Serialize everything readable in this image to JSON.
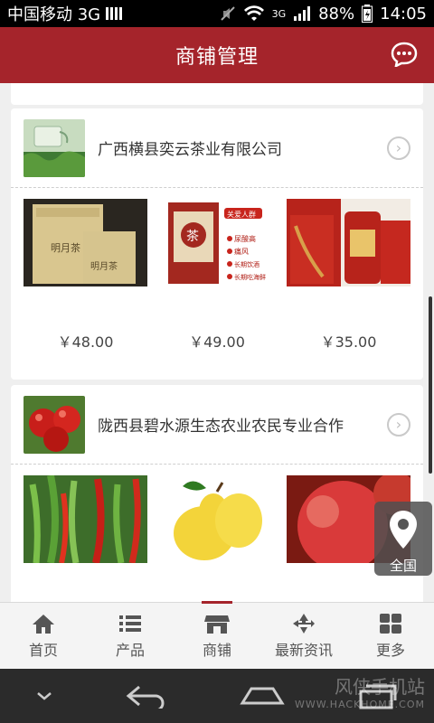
{
  "status": {
    "carrier": "中国移动 3G",
    "network": "3G",
    "battery": "88%",
    "time": "14:05"
  },
  "header": {
    "title": "商铺管理"
  },
  "shops": [
    {
      "name": "广西横县奕云茶业有限公司",
      "products": [
        {
          "price": "￥48.00"
        },
        {
          "price": "￥49.00"
        },
        {
          "price": "￥35.00"
        }
      ]
    },
    {
      "name": "陇西县碧水源生态农业农民专业合作"
    }
  ],
  "product_text": {
    "tea_box_badge": "关爱人群",
    "tea_box_items": [
      "尿酸高",
      "痛风",
      "长期饮酒",
      "长期吃海鲜"
    ]
  },
  "location_button": {
    "label": "全国"
  },
  "tabs": [
    {
      "label": "首页",
      "icon": "home-icon"
    },
    {
      "label": "产品",
      "icon": "list-icon"
    },
    {
      "label": "商铺",
      "icon": "store-icon",
      "active": true
    },
    {
      "label": "最新资讯",
      "icon": "news-icon"
    },
    {
      "label": "更多",
      "icon": "grid-icon"
    }
  ],
  "watermark": {
    "main": "风侠手机站",
    "sub": "WWW.HACKHOME.COM"
  },
  "colors": {
    "brand": "#a5242b"
  }
}
